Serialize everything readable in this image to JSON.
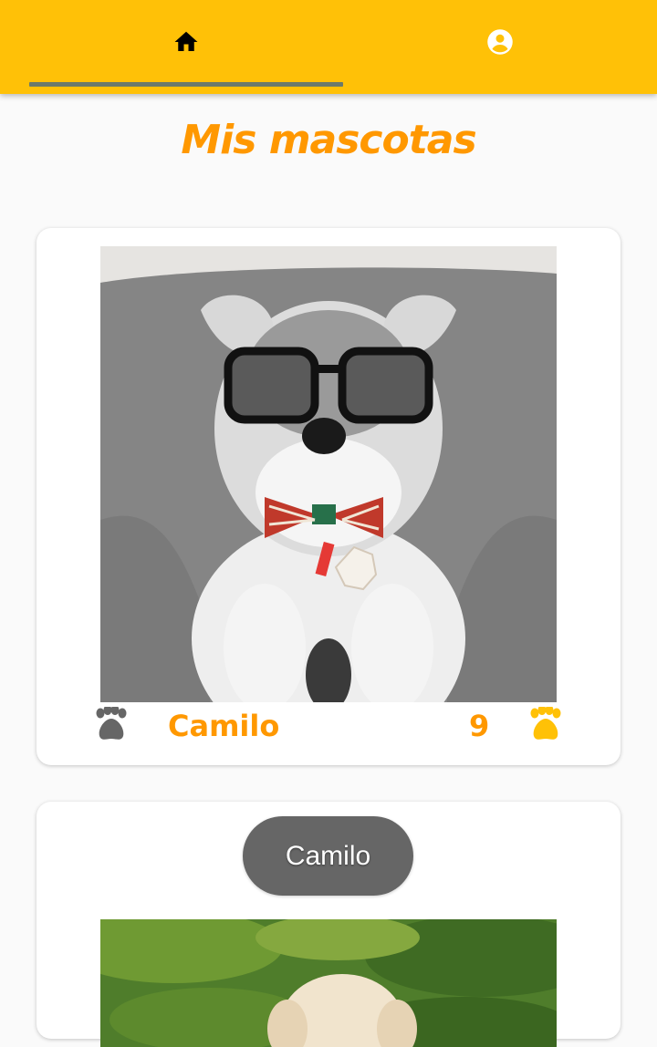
{
  "appbar": {
    "color": "#ffc107",
    "tabs": [
      {
        "icon": "home-icon",
        "selected": true
      },
      {
        "icon": "account-circle-icon",
        "selected": false
      }
    ]
  },
  "page": {
    "title": "Mis mascotas",
    "title_color": "#ff9800"
  },
  "pets": [
    {
      "name": "Camilo",
      "age": "9",
      "photo": "schnauzer-with-glasses-and-bow-tie"
    },
    {
      "chip_label": "Camilo",
      "photo": "cream-puppy-on-grass"
    }
  ]
}
